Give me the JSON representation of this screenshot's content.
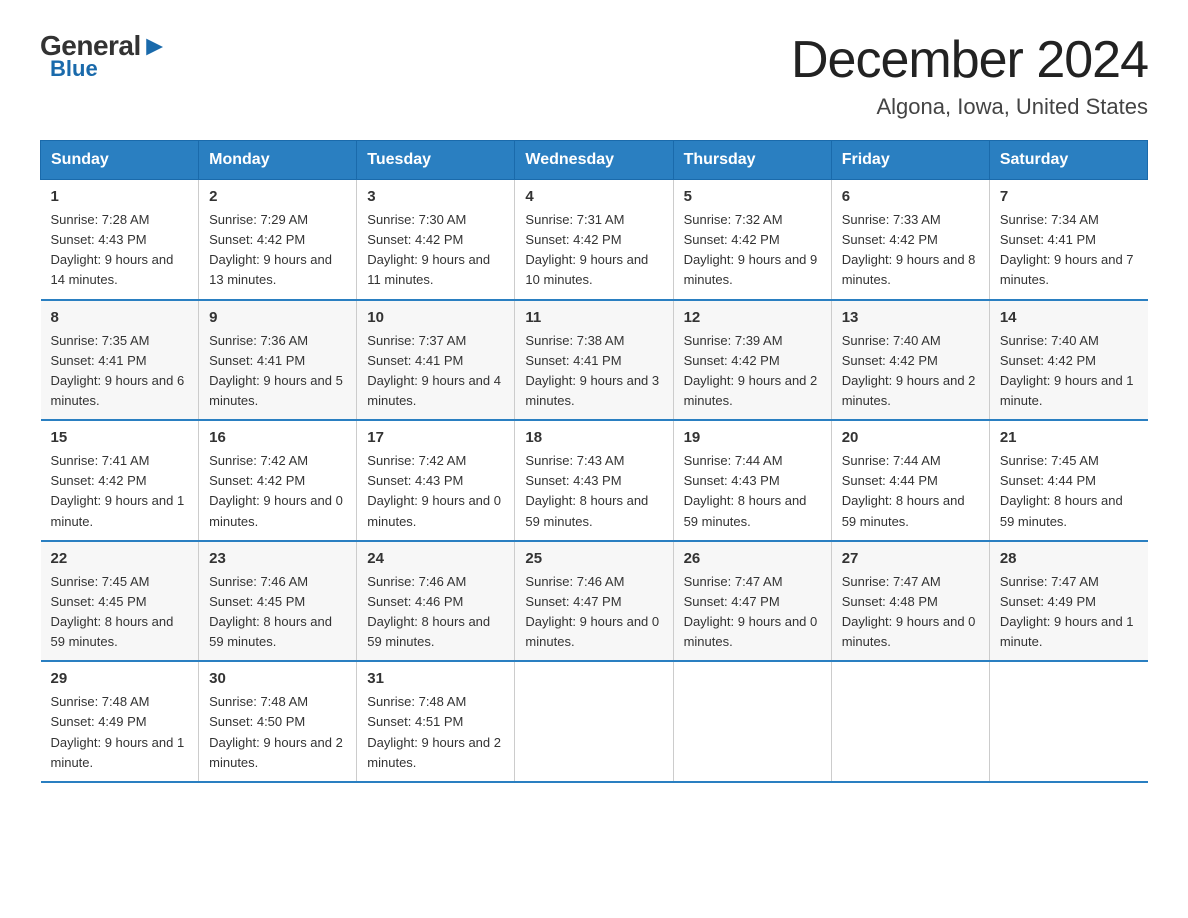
{
  "logo": {
    "general": "General",
    "blue_text": "Blue",
    "tagline": "GeneralBlue"
  },
  "title": "December 2024",
  "location": "Algona, Iowa, United States",
  "days_of_week": [
    "Sunday",
    "Monday",
    "Tuesday",
    "Wednesday",
    "Thursday",
    "Friday",
    "Saturday"
  ],
  "weeks": [
    [
      {
        "day": "1",
        "sunrise": "7:28 AM",
        "sunset": "4:43 PM",
        "daylight": "9 hours and 14 minutes."
      },
      {
        "day": "2",
        "sunrise": "7:29 AM",
        "sunset": "4:42 PM",
        "daylight": "9 hours and 13 minutes."
      },
      {
        "day": "3",
        "sunrise": "7:30 AM",
        "sunset": "4:42 PM",
        "daylight": "9 hours and 11 minutes."
      },
      {
        "day": "4",
        "sunrise": "7:31 AM",
        "sunset": "4:42 PM",
        "daylight": "9 hours and 10 minutes."
      },
      {
        "day": "5",
        "sunrise": "7:32 AM",
        "sunset": "4:42 PM",
        "daylight": "9 hours and 9 minutes."
      },
      {
        "day": "6",
        "sunrise": "7:33 AM",
        "sunset": "4:42 PM",
        "daylight": "9 hours and 8 minutes."
      },
      {
        "day": "7",
        "sunrise": "7:34 AM",
        "sunset": "4:41 PM",
        "daylight": "9 hours and 7 minutes."
      }
    ],
    [
      {
        "day": "8",
        "sunrise": "7:35 AM",
        "sunset": "4:41 PM",
        "daylight": "9 hours and 6 minutes."
      },
      {
        "day": "9",
        "sunrise": "7:36 AM",
        "sunset": "4:41 PM",
        "daylight": "9 hours and 5 minutes."
      },
      {
        "day": "10",
        "sunrise": "7:37 AM",
        "sunset": "4:41 PM",
        "daylight": "9 hours and 4 minutes."
      },
      {
        "day": "11",
        "sunrise": "7:38 AM",
        "sunset": "4:41 PM",
        "daylight": "9 hours and 3 minutes."
      },
      {
        "day": "12",
        "sunrise": "7:39 AM",
        "sunset": "4:42 PM",
        "daylight": "9 hours and 2 minutes."
      },
      {
        "day": "13",
        "sunrise": "7:40 AM",
        "sunset": "4:42 PM",
        "daylight": "9 hours and 2 minutes."
      },
      {
        "day": "14",
        "sunrise": "7:40 AM",
        "sunset": "4:42 PM",
        "daylight": "9 hours and 1 minute."
      }
    ],
    [
      {
        "day": "15",
        "sunrise": "7:41 AM",
        "sunset": "4:42 PM",
        "daylight": "9 hours and 1 minute."
      },
      {
        "day": "16",
        "sunrise": "7:42 AM",
        "sunset": "4:42 PM",
        "daylight": "9 hours and 0 minutes."
      },
      {
        "day": "17",
        "sunrise": "7:42 AM",
        "sunset": "4:43 PM",
        "daylight": "9 hours and 0 minutes."
      },
      {
        "day": "18",
        "sunrise": "7:43 AM",
        "sunset": "4:43 PM",
        "daylight": "8 hours and 59 minutes."
      },
      {
        "day": "19",
        "sunrise": "7:44 AM",
        "sunset": "4:43 PM",
        "daylight": "8 hours and 59 minutes."
      },
      {
        "day": "20",
        "sunrise": "7:44 AM",
        "sunset": "4:44 PM",
        "daylight": "8 hours and 59 minutes."
      },
      {
        "day": "21",
        "sunrise": "7:45 AM",
        "sunset": "4:44 PM",
        "daylight": "8 hours and 59 minutes."
      }
    ],
    [
      {
        "day": "22",
        "sunrise": "7:45 AM",
        "sunset": "4:45 PM",
        "daylight": "8 hours and 59 minutes."
      },
      {
        "day": "23",
        "sunrise": "7:46 AM",
        "sunset": "4:45 PM",
        "daylight": "8 hours and 59 minutes."
      },
      {
        "day": "24",
        "sunrise": "7:46 AM",
        "sunset": "4:46 PM",
        "daylight": "8 hours and 59 minutes."
      },
      {
        "day": "25",
        "sunrise": "7:46 AM",
        "sunset": "4:47 PM",
        "daylight": "9 hours and 0 minutes."
      },
      {
        "day": "26",
        "sunrise": "7:47 AM",
        "sunset": "4:47 PM",
        "daylight": "9 hours and 0 minutes."
      },
      {
        "day": "27",
        "sunrise": "7:47 AM",
        "sunset": "4:48 PM",
        "daylight": "9 hours and 0 minutes."
      },
      {
        "day": "28",
        "sunrise": "7:47 AM",
        "sunset": "4:49 PM",
        "daylight": "9 hours and 1 minute."
      }
    ],
    [
      {
        "day": "29",
        "sunrise": "7:48 AM",
        "sunset": "4:49 PM",
        "daylight": "9 hours and 1 minute."
      },
      {
        "day": "30",
        "sunrise": "7:48 AM",
        "sunset": "4:50 PM",
        "daylight": "9 hours and 2 minutes."
      },
      {
        "day": "31",
        "sunrise": "7:48 AM",
        "sunset": "4:51 PM",
        "daylight": "9 hours and 2 minutes."
      },
      {
        "day": "",
        "sunrise": "",
        "sunset": "",
        "daylight": ""
      },
      {
        "day": "",
        "sunrise": "",
        "sunset": "",
        "daylight": ""
      },
      {
        "day": "",
        "sunrise": "",
        "sunset": "",
        "daylight": ""
      },
      {
        "day": "",
        "sunrise": "",
        "sunset": "",
        "daylight": ""
      }
    ]
  ],
  "labels": {
    "sunrise_prefix": "Sunrise: ",
    "sunset_prefix": "Sunset: ",
    "daylight_prefix": "Daylight: "
  }
}
